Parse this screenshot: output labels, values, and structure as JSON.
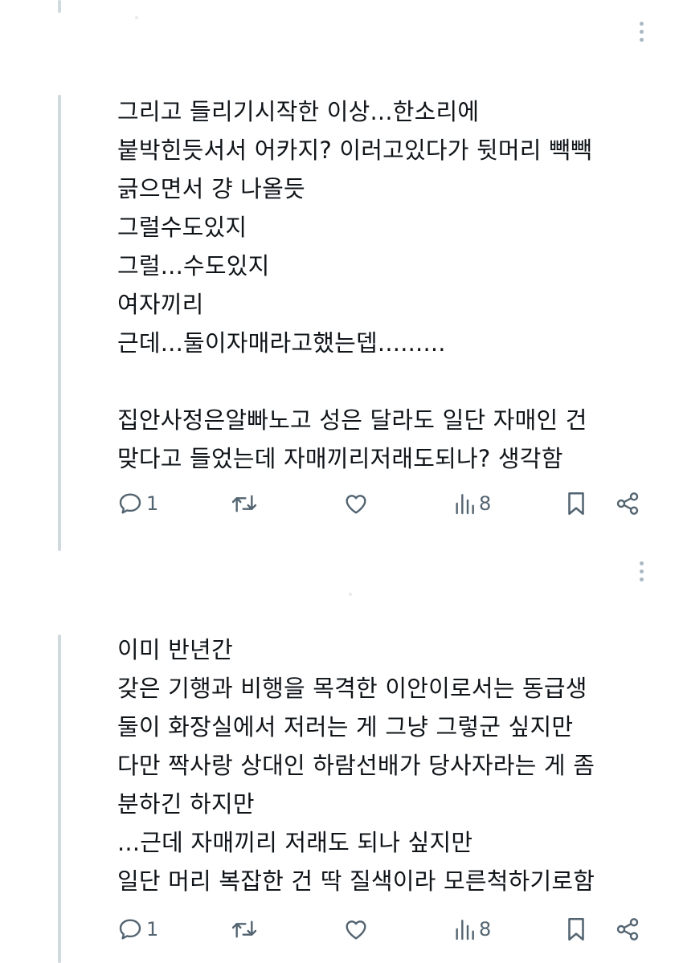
{
  "posts": [
    {
      "lines": [
        "그리고 들리기시작한 이상...한소리에",
        "붙박힌듯서서 어카지? 이러고있다가 뒷머리 빽빽",
        "긁으면서 걍 나올듯",
        "그럴수도있지",
        "그럴...수도있지",
        "여자끼리",
        "근데...둘이자매라고했는뎁.........",
        "",
        "집안사정은알빠노고 성은 달라도 일단 자매인 건",
        "맞다고 들었는데 자매끼리저래도되나? 생각함"
      ],
      "reply_count": "1",
      "view_count": "8"
    },
    {
      "lines": [
        "이미 반년간",
        "갖은 기행과 비행을 목격한 이안이로서는 동급생",
        "둘이 화장실에서 저러는 게 그냥 그렇군 싶지만",
        "다만 짝사랑 상대인 하람선배가 당사자라는 게 좀",
        "분하긴 하지만",
        "...근데 자매끼리 저래도 되나 싶지만",
        "일단 머리 복잡한 건 딱 질색이라 모른척하기로함"
      ],
      "reply_count": "1",
      "view_count": "8"
    }
  ],
  "icons": {
    "reply": "reply-bubble-icon",
    "repost": "repost-icon",
    "like": "heart-icon",
    "views": "views-bar-chart-icon",
    "bookmark": "bookmark-icon",
    "share": "share-icon",
    "more": "more-vertical-icon"
  },
  "colors": {
    "icon": "#536471",
    "thread_line": "#cfd9de",
    "text": "#0f1419"
  }
}
